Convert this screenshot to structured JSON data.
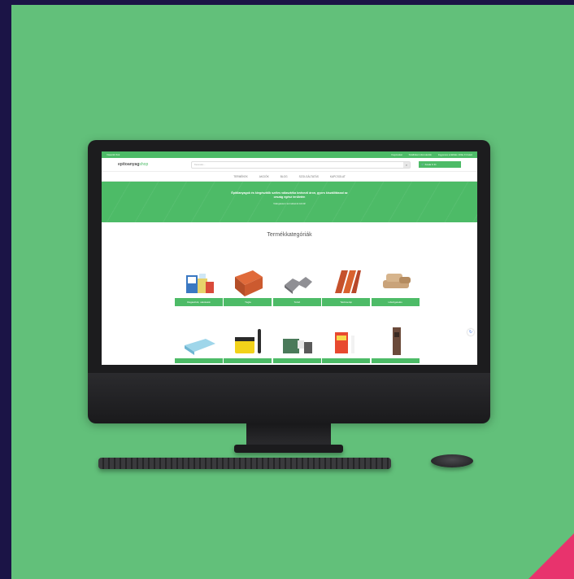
{
  "colors": {
    "background": "#62c07a",
    "accent": "#4dbb67",
    "corner": "#e8336d",
    "frame": "#1b1446"
  },
  "site": {
    "topbar": [
      "Vásárlói fiók",
      "Kapcsolat",
      "Szállítási információk",
      "Ingyenes szállítás 100e Ft felett"
    ],
    "logo": "epitoanyag",
    "logo_suffix": "shop",
    "search_placeholder": "Keresés...",
    "cart_label": "Kosár 0 Ft",
    "nav": [
      "TERMÉKEK",
      "AKCIÓK",
      "BLOG",
      "SZOLGÁLTATÁS",
      "KAPCSOLAT"
    ],
    "hero_text": "Építőanyagok és kiegészítők széles választéka kedvező áron, gyors kiszállítással az ország egész területén",
    "hero_sub": "Válogasson termékeink közül!",
    "section_title": "Termékkategóriák",
    "categories_row1": [
      "Ragasztók, vakolatok",
      "Tégla",
      "Térkő",
      "Tetőcserép",
      "Hőszigetelés"
    ],
    "categories_row2": [
      "",
      "",
      "",
      "",
      ""
    ]
  },
  "icons": [
    "apple-icon",
    "search-icon",
    "cart-icon",
    "recaptcha-icon"
  ]
}
